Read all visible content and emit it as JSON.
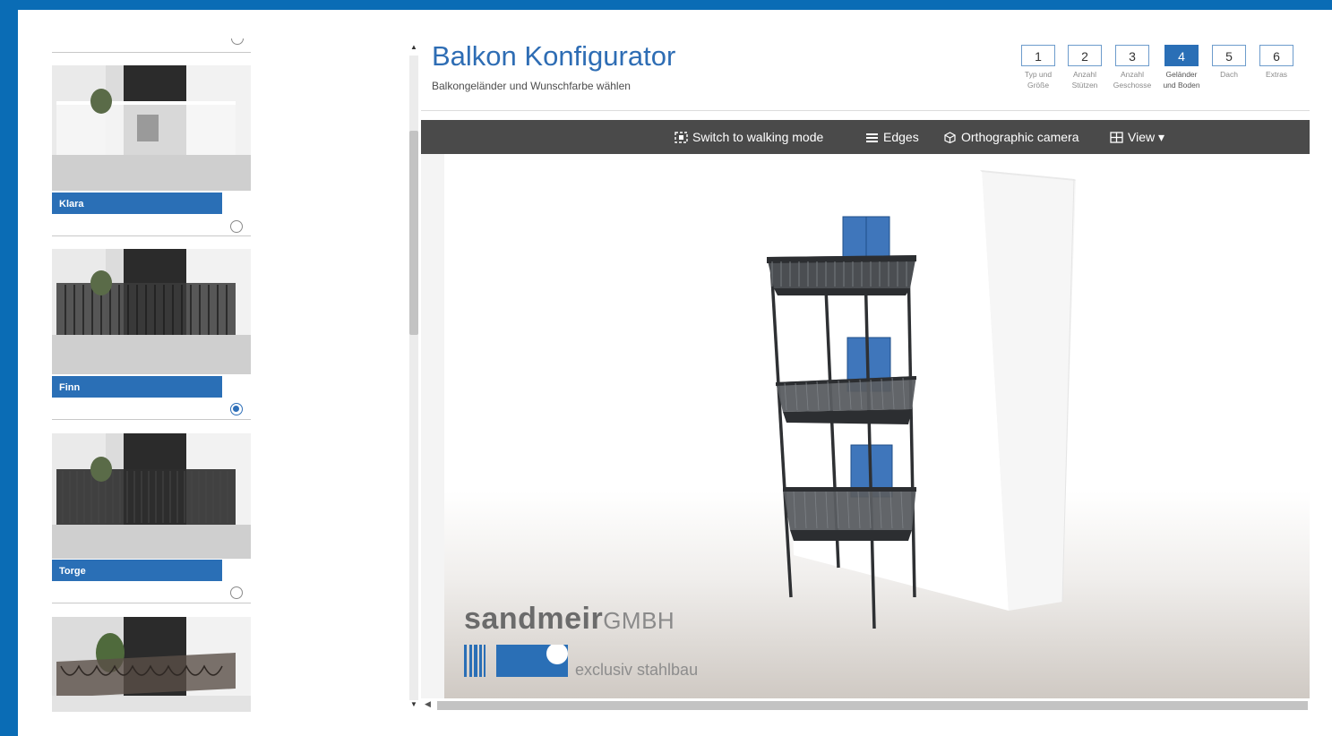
{
  "header": {
    "title": "Balkon Konfigurator",
    "subtitle": "Balkongeländer und Wunschfarbe wählen"
  },
  "steps": [
    {
      "num": "1",
      "label": "Typ und Größe",
      "active": false
    },
    {
      "num": "2",
      "label": "Anzahl Stützen",
      "active": false
    },
    {
      "num": "3",
      "label": "Anzahl Geschosse",
      "active": false
    },
    {
      "num": "4",
      "label": "Geländer und Boden",
      "active": true
    },
    {
      "num": "5",
      "label": "Dach",
      "active": false
    },
    {
      "num": "6",
      "label": "Extras",
      "active": false
    }
  ],
  "toolbar": {
    "walking": "Switch to walking mode",
    "edges": "Edges",
    "camera": "Orthographic camera",
    "view": "View ▾"
  },
  "options": [
    {
      "name": "Klara",
      "selected": false
    },
    {
      "name": "Finn",
      "selected": true
    },
    {
      "name": "Torge",
      "selected": false
    },
    {
      "name": "",
      "selected": false
    }
  ],
  "brand": {
    "name_bold": "sandmeir",
    "name_light": "GMBH",
    "tagline": "exclusiv stahlbau"
  },
  "colors": {
    "accent": "#2a6fb6",
    "frame": "#0a6cb5",
    "toolbar": "#4a4a4a"
  }
}
